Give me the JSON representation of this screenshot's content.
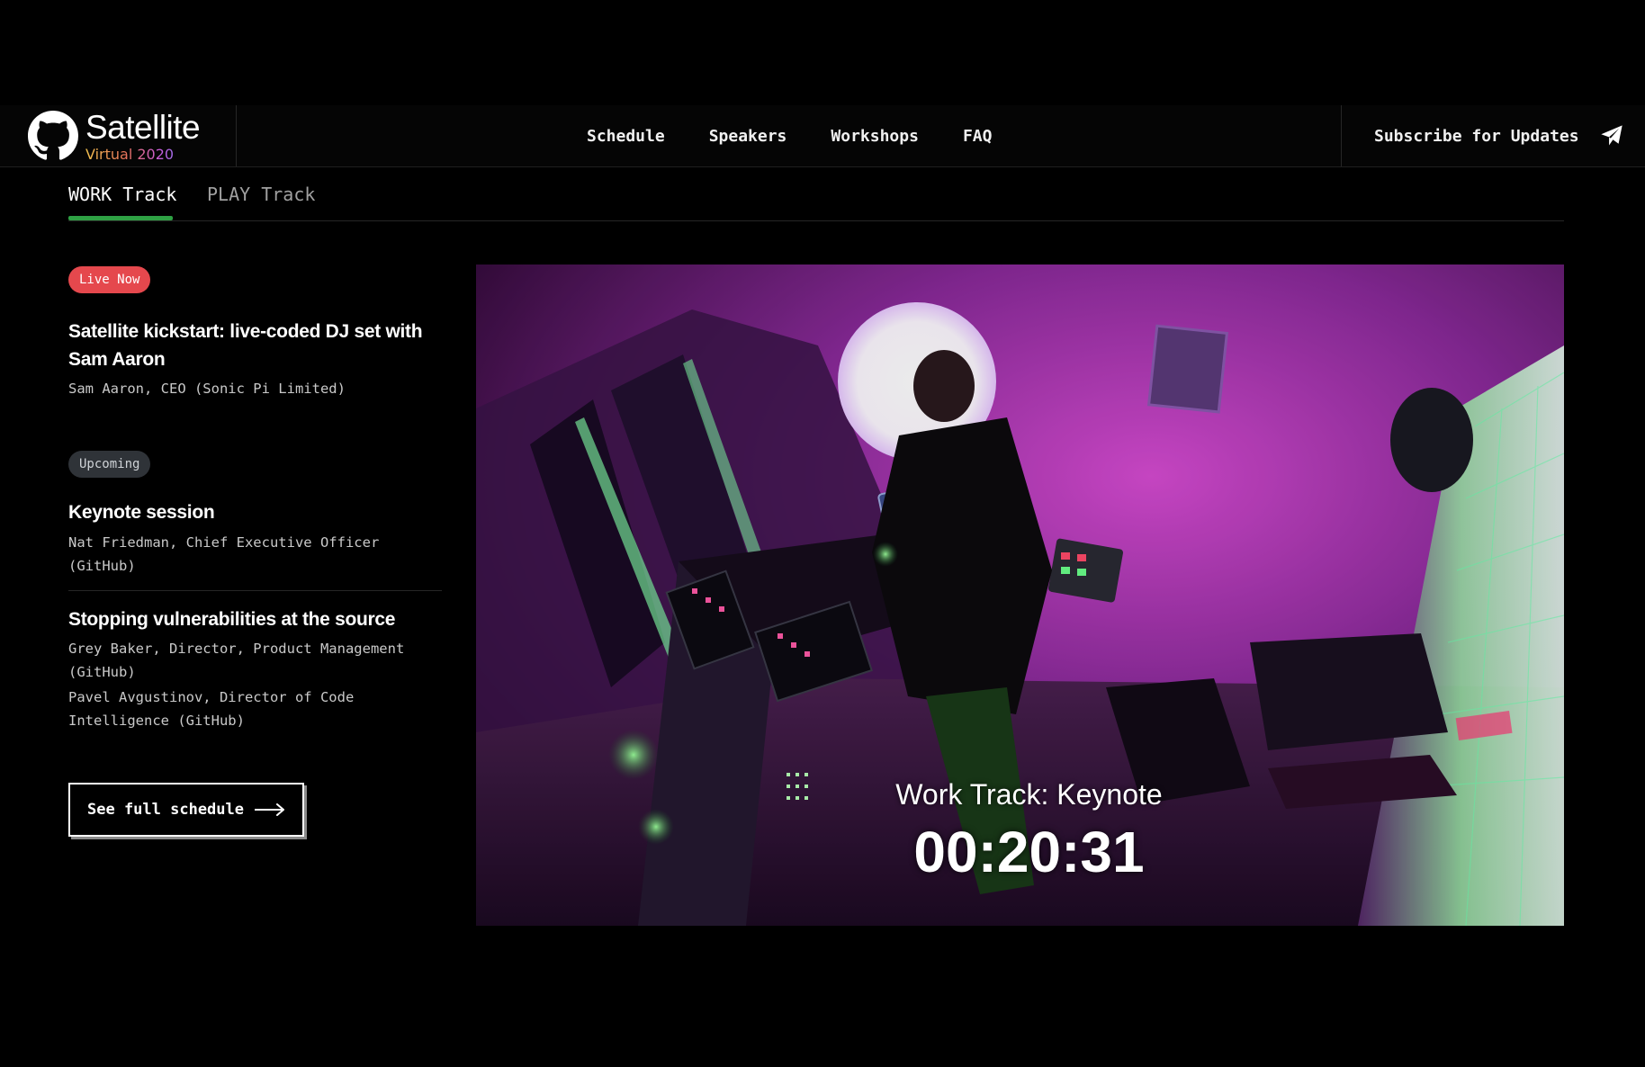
{
  "header": {
    "logo_title": "Satellite",
    "logo_subtitle": "Virtual 2020",
    "nav": [
      {
        "label": "Schedule"
      },
      {
        "label": "Speakers"
      },
      {
        "label": "Workshops"
      },
      {
        "label": "FAQ"
      }
    ],
    "subscribe_label": "Subscribe for Updates"
  },
  "tabs": [
    {
      "label": "WORK Track",
      "active": true
    },
    {
      "label": "PLAY Track",
      "active": false
    }
  ],
  "sessions": {
    "live": {
      "badge": "Live Now",
      "title": "Satellite kickstart: live-coded DJ set with Sam Aaron",
      "speakers": [
        "Sam Aaron, CEO (Sonic Pi Limited)"
      ]
    },
    "upcoming_badge": "Upcoming",
    "upcoming": [
      {
        "title": "Keynote session",
        "speakers": [
          "Nat Friedman, Chief Executive Officer (GitHub)"
        ]
      },
      {
        "title": "Stopping vulnerabilities at the source",
        "speakers": [
          "Grey Baker, Director, Product Management (GitHub)",
          "Pavel Avgustinov, Director of Code Intelligence (GitHub)"
        ]
      }
    ]
  },
  "schedule_button_label": "See full schedule",
  "video": {
    "caption": "Work Track: Keynote",
    "timer": "00:20:31"
  },
  "colors": {
    "accent_green": "#2ea043",
    "live_red": "#e5484d",
    "upcoming_gray": "#2f3338"
  },
  "icons": {
    "logo": "github-octocat-icon",
    "subscribe": "paper-plane-icon",
    "schedule_button": "arrow-right-icon"
  }
}
